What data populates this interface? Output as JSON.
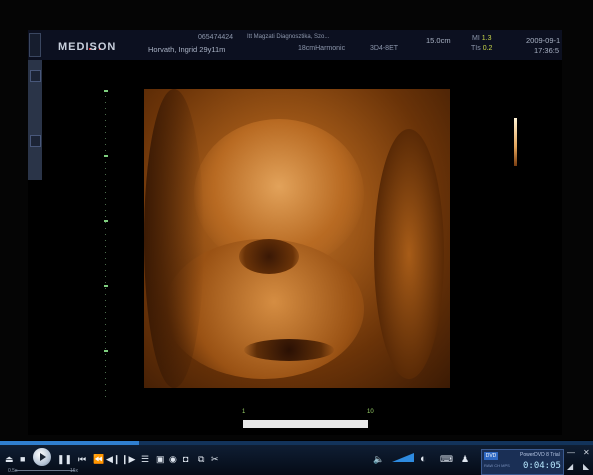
{
  "ultrasound": {
    "brand": "MEDISON",
    "patient_id": "065474424",
    "institution": "Itt Magzati Diagnosztika, Szo...",
    "patient_name": "Horvath, Ingrid 29y11m",
    "preset": "18cmHarmonic",
    "probe": "3D4-8ET",
    "depth": "15.0cm",
    "mi_label": "MI",
    "mi_value": "1.3",
    "tis_label": "TIs",
    "tis_value": "0.2",
    "date": "2009-09-1",
    "time": "17:36:5",
    "scale_start": "1",
    "scale_end": "10"
  },
  "player": {
    "progress": 0.235,
    "timecode": "0:04:05",
    "product_name": "PowerDVD 8 Trial",
    "logo_text": "DVD",
    "info_text": "RAW  CH  MPS",
    "speed_min": "0.5x",
    "speed_max": "16x",
    "icons": [
      "eject-icon",
      "stop-icon",
      "play-icon",
      "pause-icon",
      "prev-chapter-icon",
      "rewind-icon",
      "step-back-icon",
      "step-forward-icon",
      "menu-icon",
      "repeat-icon",
      "snapshot-icon",
      "zoom-icon",
      "subtitle-icon",
      "audio-icon",
      "volume-icon",
      "capture-icon",
      "settings-icon",
      "help-icon",
      "minimize-icon",
      "close-icon"
    ]
  }
}
